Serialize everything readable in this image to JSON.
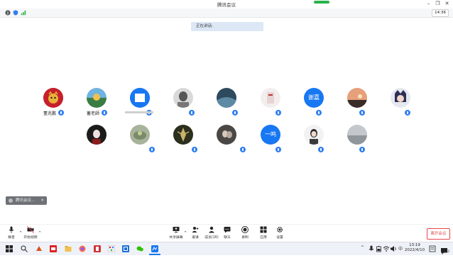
{
  "window": {
    "title": "腾讯会议"
  },
  "infobar": {
    "time": "14:36"
  },
  "banner": {
    "speaking": "正在讲话:"
  },
  "participants": [
    {
      "name": "董兆鹏"
    },
    {
      "name": "蓄老師"
    },
    {
      "name": ""
    },
    {
      "name": ""
    },
    {
      "name": ""
    },
    {
      "name": ""
    },
    {
      "name": "",
      "avatar_text": "谢嘉"
    },
    {
      "name": ""
    },
    {
      "name": ""
    },
    {
      "name": ""
    },
    {
      "name": ""
    },
    {
      "name": ""
    },
    {
      "name": ""
    },
    {
      "name": "",
      "avatar_text": "一鸣"
    },
    {
      "name": ""
    },
    {
      "name": ""
    }
  ],
  "mini_window": {
    "label": "腾讯会议..."
  },
  "toolbar": {
    "mute": "静音",
    "video": "开始视频",
    "share": "共享屏幕",
    "invite": "邀请",
    "members": "成员(16)",
    "chat": "聊天",
    "record": "录制",
    "apps": "应用",
    "settings": "设置",
    "leave": "离开会议"
  },
  "taskbar": {
    "ime": "中",
    "time": "13:19",
    "date": "2022/4/10",
    "notifications": "2"
  },
  "colors": {
    "accent": "#2f7ef0",
    "leave": "#e5484d",
    "green": "#29b34a"
  }
}
